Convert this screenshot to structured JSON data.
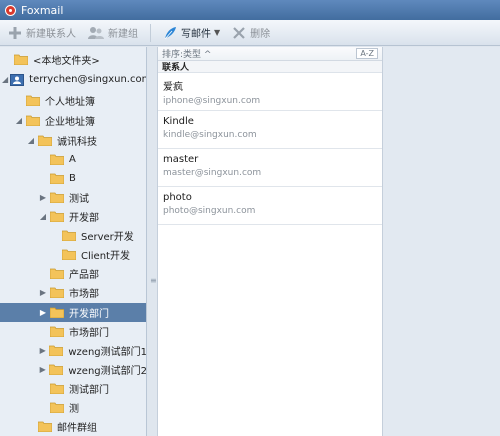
{
  "app": {
    "title": "Foxmail"
  },
  "toolbar": {
    "new_contact": "新建联系人",
    "new_group": "新建组",
    "write_mail": "写邮件",
    "delete": "删除"
  },
  "sidebar": {
    "items": [
      {
        "label": "<本地文件夹>",
        "arrow": "",
        "icon": "folder"
      },
      {
        "label": "terrychen@singxun.com",
        "arrow": "◢",
        "icon": "person"
      },
      {
        "label": "个人地址簿",
        "arrow": "",
        "icon": "folder"
      },
      {
        "label": "企业地址簿",
        "arrow": "◢",
        "icon": "folder"
      },
      {
        "label": "诚讯科技",
        "arrow": "◢",
        "icon": "folder"
      },
      {
        "label": "A",
        "arrow": "",
        "icon": "folder"
      },
      {
        "label": "B",
        "arrow": "",
        "icon": "folder"
      },
      {
        "label": "测试",
        "arrow": "▶",
        "icon": "folder"
      },
      {
        "label": "开发部",
        "arrow": "◢",
        "icon": "folder"
      },
      {
        "label": "Server开发",
        "arrow": "",
        "icon": "folder"
      },
      {
        "label": "Client开发",
        "arrow": "",
        "icon": "folder"
      },
      {
        "label": "产品部",
        "arrow": "",
        "icon": "folder"
      },
      {
        "label": "市场部",
        "arrow": "▶",
        "icon": "folder"
      },
      {
        "label": "开发部门",
        "arrow": "▶",
        "icon": "folder",
        "selected": true
      },
      {
        "label": "市场部门",
        "arrow": "",
        "icon": "folder"
      },
      {
        "label": "wzeng测试部门1",
        "arrow": "▶",
        "icon": "folder"
      },
      {
        "label": "wzeng测试部门2",
        "arrow": "▶",
        "icon": "folder"
      },
      {
        "label": "测试部门",
        "arrow": "",
        "icon": "folder"
      },
      {
        "label": "测",
        "arrow": "",
        "icon": "folder"
      },
      {
        "label": "邮件群组",
        "arrow": "",
        "icon": "folder"
      }
    ]
  },
  "contacts": {
    "sort_label": "排序:类型 ^",
    "az": "A-Z",
    "group_header": "联系人",
    "list": [
      {
        "name": "爱疯",
        "email": "iphone@singxun.com"
      },
      {
        "name": "Kindle",
        "email": "kindle@singxun.com"
      },
      {
        "name": "master",
        "email": "master@singxun.com"
      },
      {
        "name": "photo",
        "email": "photo@singxun.com"
      }
    ]
  },
  "colors": {
    "title_bar": "#4e7aad",
    "selection": "#5b7fa9",
    "folder": "#f3c35a"
  }
}
